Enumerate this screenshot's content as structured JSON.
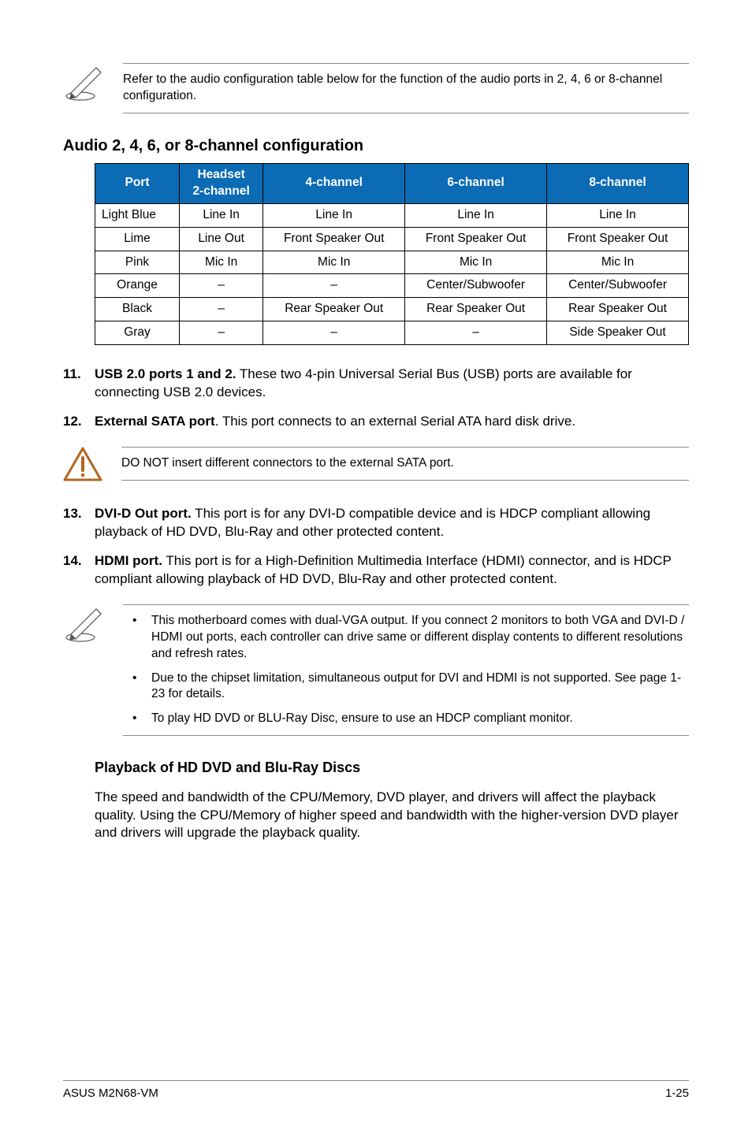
{
  "note1": "Refer to the audio configuration table below for the function of the audio ports in 2, 4, 6 or 8-channel configuration.",
  "audioSection": {
    "title": "Audio 2, 4, 6, or 8-channel configuration",
    "headers": {
      "port": "Port",
      "headset_line1": "Headset",
      "headset_line2": "2-channel",
      "c4": "4-channel",
      "c6": "6-channel",
      "c8": "8-channel"
    },
    "rows": [
      {
        "port": "Light Blue",
        "h": "Line In",
        "c4": "Line In",
        "c6": "Line In",
        "c8": "Line In"
      },
      {
        "port": "Lime",
        "h": "Line Out",
        "c4": "Front Speaker Out",
        "c6": "Front Speaker Out",
        "c8": "Front Speaker Out"
      },
      {
        "port": "Pink",
        "h": "Mic In",
        "c4": "Mic In",
        "c6": "Mic In",
        "c8": "Mic In"
      },
      {
        "port": "Orange",
        "h": "–",
        "c4": "–",
        "c6": "Center/Subwoofer",
        "c8": "Center/Subwoofer"
      },
      {
        "port": "Black",
        "h": "–",
        "c4": "Rear Speaker Out",
        "c6": "Rear Speaker Out",
        "c8": "Rear Speaker Out"
      },
      {
        "port": "Gray",
        "h": "–",
        "c4": "–",
        "c6": "–",
        "c8": "Side Speaker Out"
      }
    ]
  },
  "list1": [
    {
      "num": "11.",
      "lead": "USB 2.0 ports 1 and 2.",
      "rest": " These two 4-pin Universal Serial Bus (USB) ports are available for connecting USB 2.0 devices."
    },
    {
      "num": "12.",
      "lead": "External SATA port",
      "rest": ". This port connects to an external Serial ATA hard disk drive."
    }
  ],
  "warn1": "DO NOT insert different connectors to the external SATA port.",
  "list2": [
    {
      "num": "13.",
      "lead": "DVI-D Out port.",
      "rest": " This port is for any DVI-D compatible device and is HDCP compliant allowing playback of HD DVD, Blu-Ray and other protected content."
    },
    {
      "num": "14.",
      "lead": "HDMI port.",
      "rest": " This port is for a High-Definition Multimedia Interface (HDMI) connector, and is HDCP compliant allowing playback of HD DVD, Blu-Ray and other protected content."
    }
  ],
  "note2": [
    "This motherboard comes with dual-VGA output. If you connect 2 monitors to both VGA and DVI-D / HDMI out ports, each controller can drive same or different display contents to different resolutions and refresh rates.",
    "Due to the chipset limitation, simultaneous output for DVI and HDMI is not supported. See page 1-23 for details.",
    "To play HD DVD or BLU-Ray Disc, ensure to use an HDCP compliant monitor."
  ],
  "playback": {
    "title": "Playback of HD DVD and Blu-Ray Discs",
    "body": "The speed and bandwidth of the CPU/Memory, DVD player, and drivers will affect the playback quality. Using the CPU/Memory of higher speed and bandwidth with the higher-version DVD player and drivers will upgrade the playback quality."
  },
  "footer": {
    "left": "ASUS M2N68-VM",
    "right": "1-25"
  }
}
